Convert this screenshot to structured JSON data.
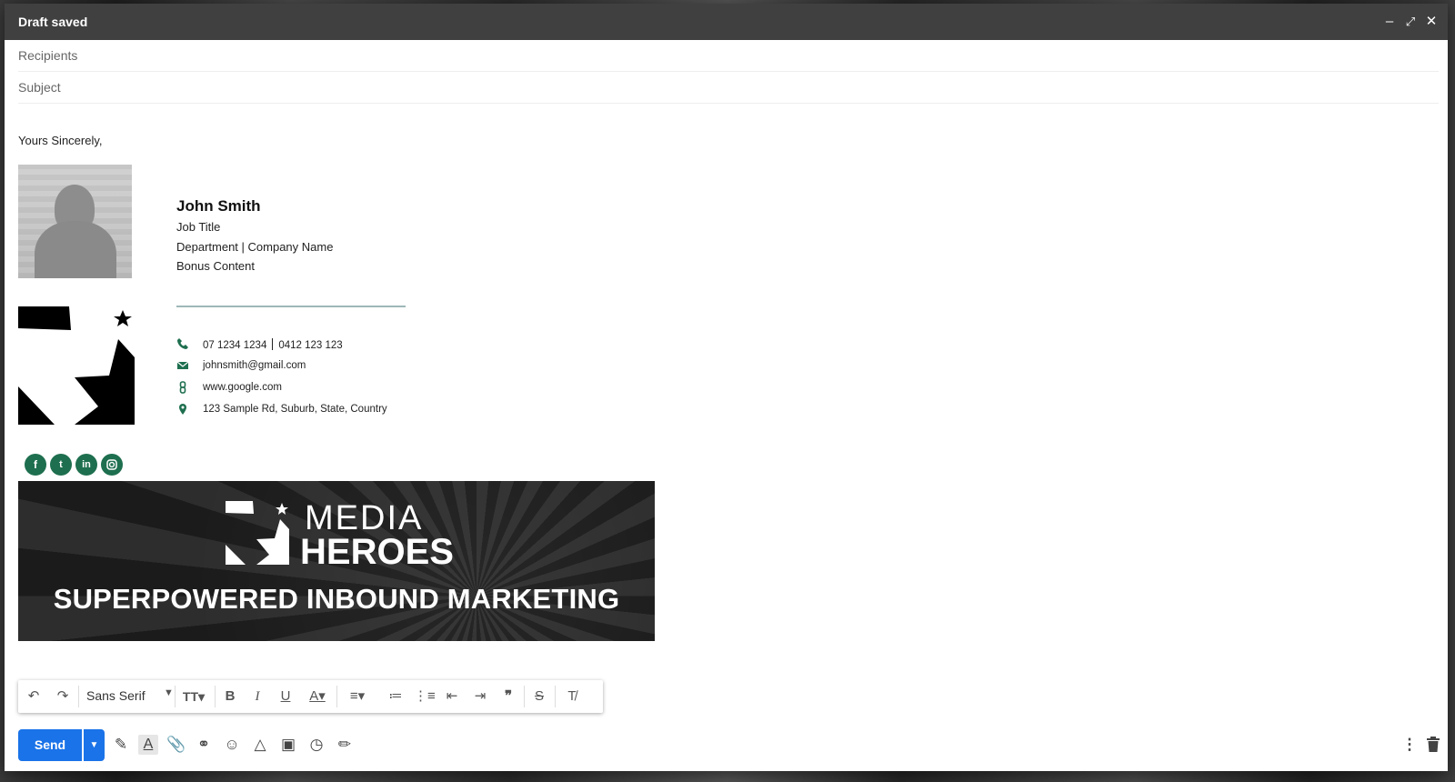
{
  "window": {
    "title": "Draft saved",
    "controls": [
      "minimize-icon",
      "expand-icon",
      "close-icon"
    ]
  },
  "fields": {
    "recipients_placeholder": "Recipients",
    "subject_placeholder": "Subject"
  },
  "body": {
    "closing": "Yours Sincerely,"
  },
  "signature": {
    "name": "John Smith",
    "job_title": "Job Title",
    "department": "Department | Company Name",
    "bonus": "Bonus Content",
    "phone1": "07 1234 1234",
    "phone2": "0412 123 123",
    "email": "johnsmith@gmail.com",
    "website": "www.google.com",
    "address": "123 Sample Rd, Suburb, State, Country",
    "social": [
      "facebook-icon",
      "twitter-icon",
      "linkedin-icon",
      "instagram-icon"
    ],
    "accent_color": "#1e6f4f"
  },
  "banner": {
    "brand_line1": "MEDIA",
    "brand_line2": "HEROES",
    "headline": "SUPERPOWERED INBOUND MARKETING"
  },
  "format_toolbar": {
    "font": "Sans Serif",
    "buttons": [
      "undo-icon",
      "redo-icon",
      "font-size-icon",
      "bold-icon",
      "italic-icon",
      "underline-icon",
      "text-color-icon",
      "align-icon",
      "numbered-list-icon",
      "bulleted-list-icon",
      "indent-less-icon",
      "indent-more-icon",
      "quote-icon",
      "strikethrough-icon",
      "remove-formatting-icon"
    ]
  },
  "bottom_toolbar": {
    "send_label": "Send",
    "send_color": "#1a73e8",
    "tools": [
      "formatting-options-icon",
      "attach-icon",
      "link-icon",
      "emoji-icon",
      "drive-icon",
      "photo-icon",
      "confidential-icon",
      "signature-icon"
    ],
    "right": [
      "more-options-icon",
      "discard-icon"
    ]
  }
}
